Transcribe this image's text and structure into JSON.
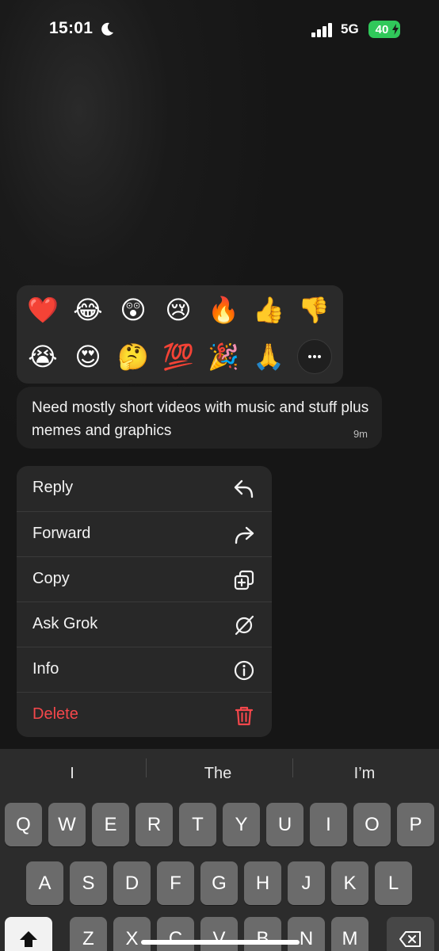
{
  "status_bar": {
    "time": "15:01",
    "network": "5G",
    "battery": "40"
  },
  "reactions": {
    "emojis": [
      "❤️",
      "😂",
      "😲",
      "😢",
      "🔥",
      "👍",
      "👎",
      "😭",
      "😍",
      "🤔",
      "💯",
      "🎉",
      "🙏"
    ],
    "more_icon": "ellipsis-icon"
  },
  "message": {
    "text": "Need mostly short videos with music and stuff plus memes and graphics",
    "time": "9m"
  },
  "context_menu": {
    "items": [
      {
        "label": "Reply",
        "icon": "reply-icon"
      },
      {
        "label": "Forward",
        "icon": "forward-icon"
      },
      {
        "label": "Copy",
        "icon": "copy-icon"
      },
      {
        "label": "Ask Grok",
        "icon": "grok-icon"
      },
      {
        "label": "Info",
        "icon": "info-icon"
      },
      {
        "label": "Delete",
        "icon": "trash-icon",
        "color": "#f4474b"
      }
    ]
  },
  "keyboard": {
    "suggestions": [
      "I",
      "The",
      "I’m"
    ],
    "row1": [
      "Q",
      "W",
      "E",
      "R",
      "T",
      "Y",
      "U",
      "I",
      "O",
      "P"
    ],
    "row2": [
      "A",
      "S",
      "D",
      "F",
      "G",
      "H",
      "J",
      "K",
      "L"
    ],
    "row3": [
      "Z",
      "X",
      "C",
      "V",
      "B",
      "N",
      "M"
    ]
  },
  "colors": {
    "delete": "#f4474b",
    "battery": "#30c85a"
  }
}
